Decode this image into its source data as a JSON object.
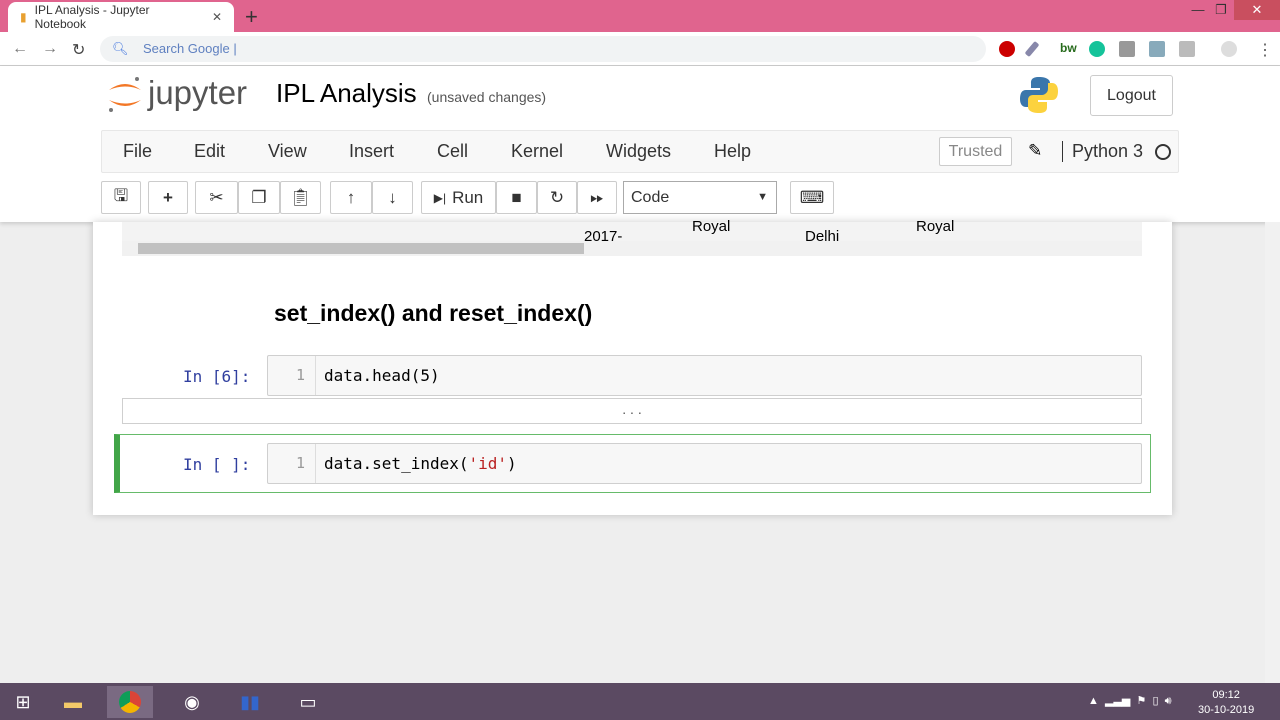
{
  "browser": {
    "tab_title": "IPL Analysis - Jupyter Notebook",
    "omnibox_placeholder": "Search Google",
    "close": "✕",
    "new_tab": "+",
    "extensions": [
      "adblock-icon",
      "eyedropper-icon",
      "bw-icon",
      "grammarly-icon",
      "ext-icon",
      "ext2-icon",
      "ext3-icon",
      "profile-icon"
    ]
  },
  "header": {
    "brand": "jupyter",
    "title": "IPL Analysis",
    "status": "(unsaved changes)",
    "logout": "Logout"
  },
  "menubar": {
    "items": [
      "File",
      "Edit",
      "View",
      "Insert",
      "Cell",
      "Kernel",
      "Widgets",
      "Help"
    ],
    "trusted": "Trusted",
    "kernel": "Python 3"
  },
  "toolbar": {
    "run_label": "Run",
    "cell_type": "Code"
  },
  "output_fragments": [
    "2017-",
    "Royal",
    "Delhi",
    "Royal"
  ],
  "markdown": {
    "heading": "set_index() and reset_index()"
  },
  "cells": [
    {
      "prompt": "In [6]:",
      "line": "1",
      "code": "data.head(5)"
    },
    {
      "prompt": "In [ ]:",
      "line": "1",
      "code_pre": "data.set_index(",
      "code_str": "'id'",
      "code_post": ")"
    }
  ],
  "collapsed_output": ". . .",
  "taskbar": {
    "time": "09:12",
    "date": "30-10-2019"
  },
  "colors": {
    "tabbar": "#e0648e",
    "selected_cell": "#42a548",
    "taskbar": "#5b4a62"
  }
}
